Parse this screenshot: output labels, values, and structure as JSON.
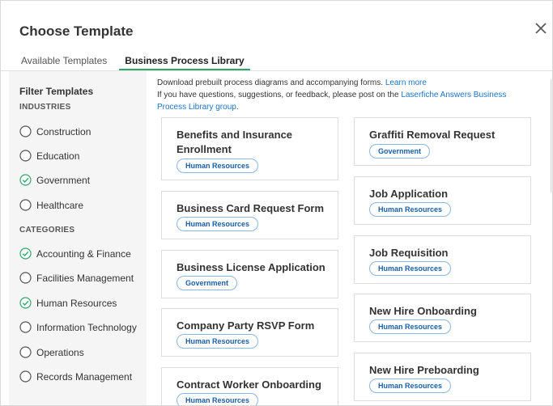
{
  "dialog": {
    "title": "Choose Template"
  },
  "tabs": [
    {
      "label": "Available Templates"
    },
    {
      "label": "Business Process Library"
    }
  ],
  "filters": {
    "heading": "Filter Templates",
    "industries_heading": "INDUSTRIES",
    "industries": [
      {
        "label": "Construction",
        "checked": false
      },
      {
        "label": "Education",
        "checked": false
      },
      {
        "label": "Government",
        "checked": true
      },
      {
        "label": "Healthcare",
        "checked": false
      }
    ],
    "categories_heading": "CATEGORIES",
    "categories": [
      {
        "label": "Accounting & Finance",
        "checked": true
      },
      {
        "label": "Facilities Management",
        "checked": false
      },
      {
        "label": "Human Resources",
        "checked": true
      },
      {
        "label": "Information Technology",
        "checked": false
      },
      {
        "label": "Operations",
        "checked": false
      },
      {
        "label": "Records Management",
        "checked": false
      }
    ]
  },
  "info": {
    "line1": "Download prebuilt process diagrams and accompanying forms.",
    "learn_more": "Learn more",
    "line2": "If you have questions, suggestions, or feedback, please post on the",
    "group_link": "Laserfiche Answers Business Process Library group",
    "period": "."
  },
  "templates_left": [
    {
      "title": "Benefits and Insurance Enrollment",
      "tag": "Human Resources"
    },
    {
      "title": "Business Card Request Form",
      "tag": "Human Resources"
    },
    {
      "title": "Business License Application",
      "tag": "Government"
    },
    {
      "title": "Company Party RSVP Form",
      "tag": "Human Resources"
    },
    {
      "title": "Contract Worker Onboarding",
      "tag": "Human Resources"
    }
  ],
  "templates_right": [
    {
      "title": "Graffiti Removal Request",
      "tag": "Government"
    },
    {
      "title": "Job Application",
      "tag": "Human Resources"
    },
    {
      "title": "Job Requisition",
      "tag": "Human Resources"
    },
    {
      "title": "New Hire Onboarding",
      "tag": "Human Resources"
    },
    {
      "title": "New Hire Preboarding",
      "tag": "Human Resources"
    }
  ],
  "colors": {
    "accent_green": "#2ea869",
    "link_blue": "#1a73c8",
    "badge_border": "#8ab6e6"
  }
}
